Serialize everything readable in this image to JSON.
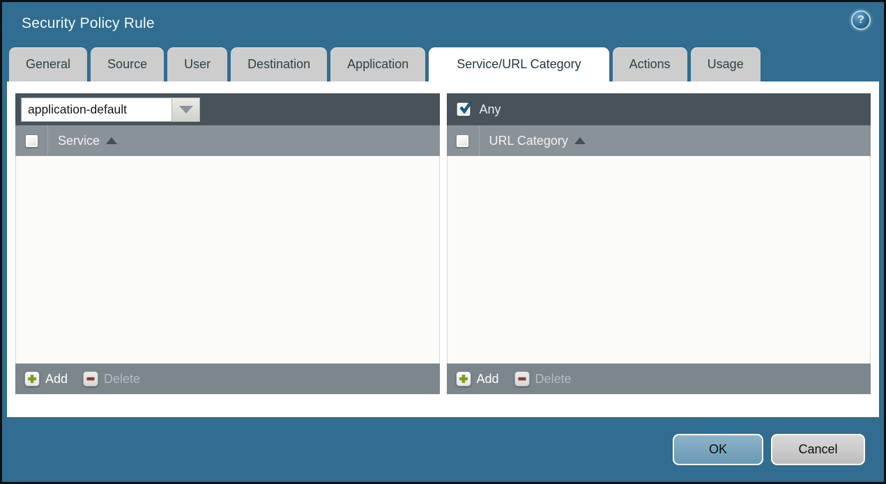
{
  "dialog": {
    "title": "Security Policy Rule"
  },
  "help": {
    "glyph": "?"
  },
  "tabs": [
    {
      "label": "General",
      "active": false
    },
    {
      "label": "Source",
      "active": false
    },
    {
      "label": "User",
      "active": false
    },
    {
      "label": "Destination",
      "active": false
    },
    {
      "label": "Application",
      "active": false
    },
    {
      "label": "Service/URL Category",
      "active": true
    },
    {
      "label": "Actions",
      "active": false
    },
    {
      "label": "Usage",
      "active": false
    }
  ],
  "service_panel": {
    "selector_value": "application-default",
    "columns": [
      "Service"
    ],
    "rows": [],
    "add_label": "Add",
    "delete_label": "Delete",
    "delete_enabled": false
  },
  "url_category_panel": {
    "any_checkbox": {
      "label": "Any",
      "checked": true
    },
    "columns": [
      "URL Category"
    ],
    "rows": [],
    "add_label": "Add",
    "delete_label": "Delete",
    "delete_enabled": false
  },
  "buttons": {
    "ok_label": "OK",
    "cancel_label": "Cancel"
  },
  "icons": {
    "help": "question-mark-circle",
    "combo_arrow": "triangle-down",
    "sort": "triangle-up-ascending",
    "add": "green-plus-box",
    "delete": "red-minus-box",
    "any_checked": "blue-checkmark"
  },
  "colors": {
    "titlebar_teal": "#306d90",
    "dark_band": "#47525a",
    "table_header_gray": "#8a9299",
    "footer_gray": "#7b868d",
    "tab_gray": "#cdcdcd",
    "active_tab": "#ffffff",
    "ok_button_blue": "#74a5bd",
    "cancel_button_gray": "#c9c9c9",
    "add_plus_green": "#7f9c24",
    "delete_minus_red": "#8c3a2e",
    "checkmark_blue": "#1e567d"
  }
}
